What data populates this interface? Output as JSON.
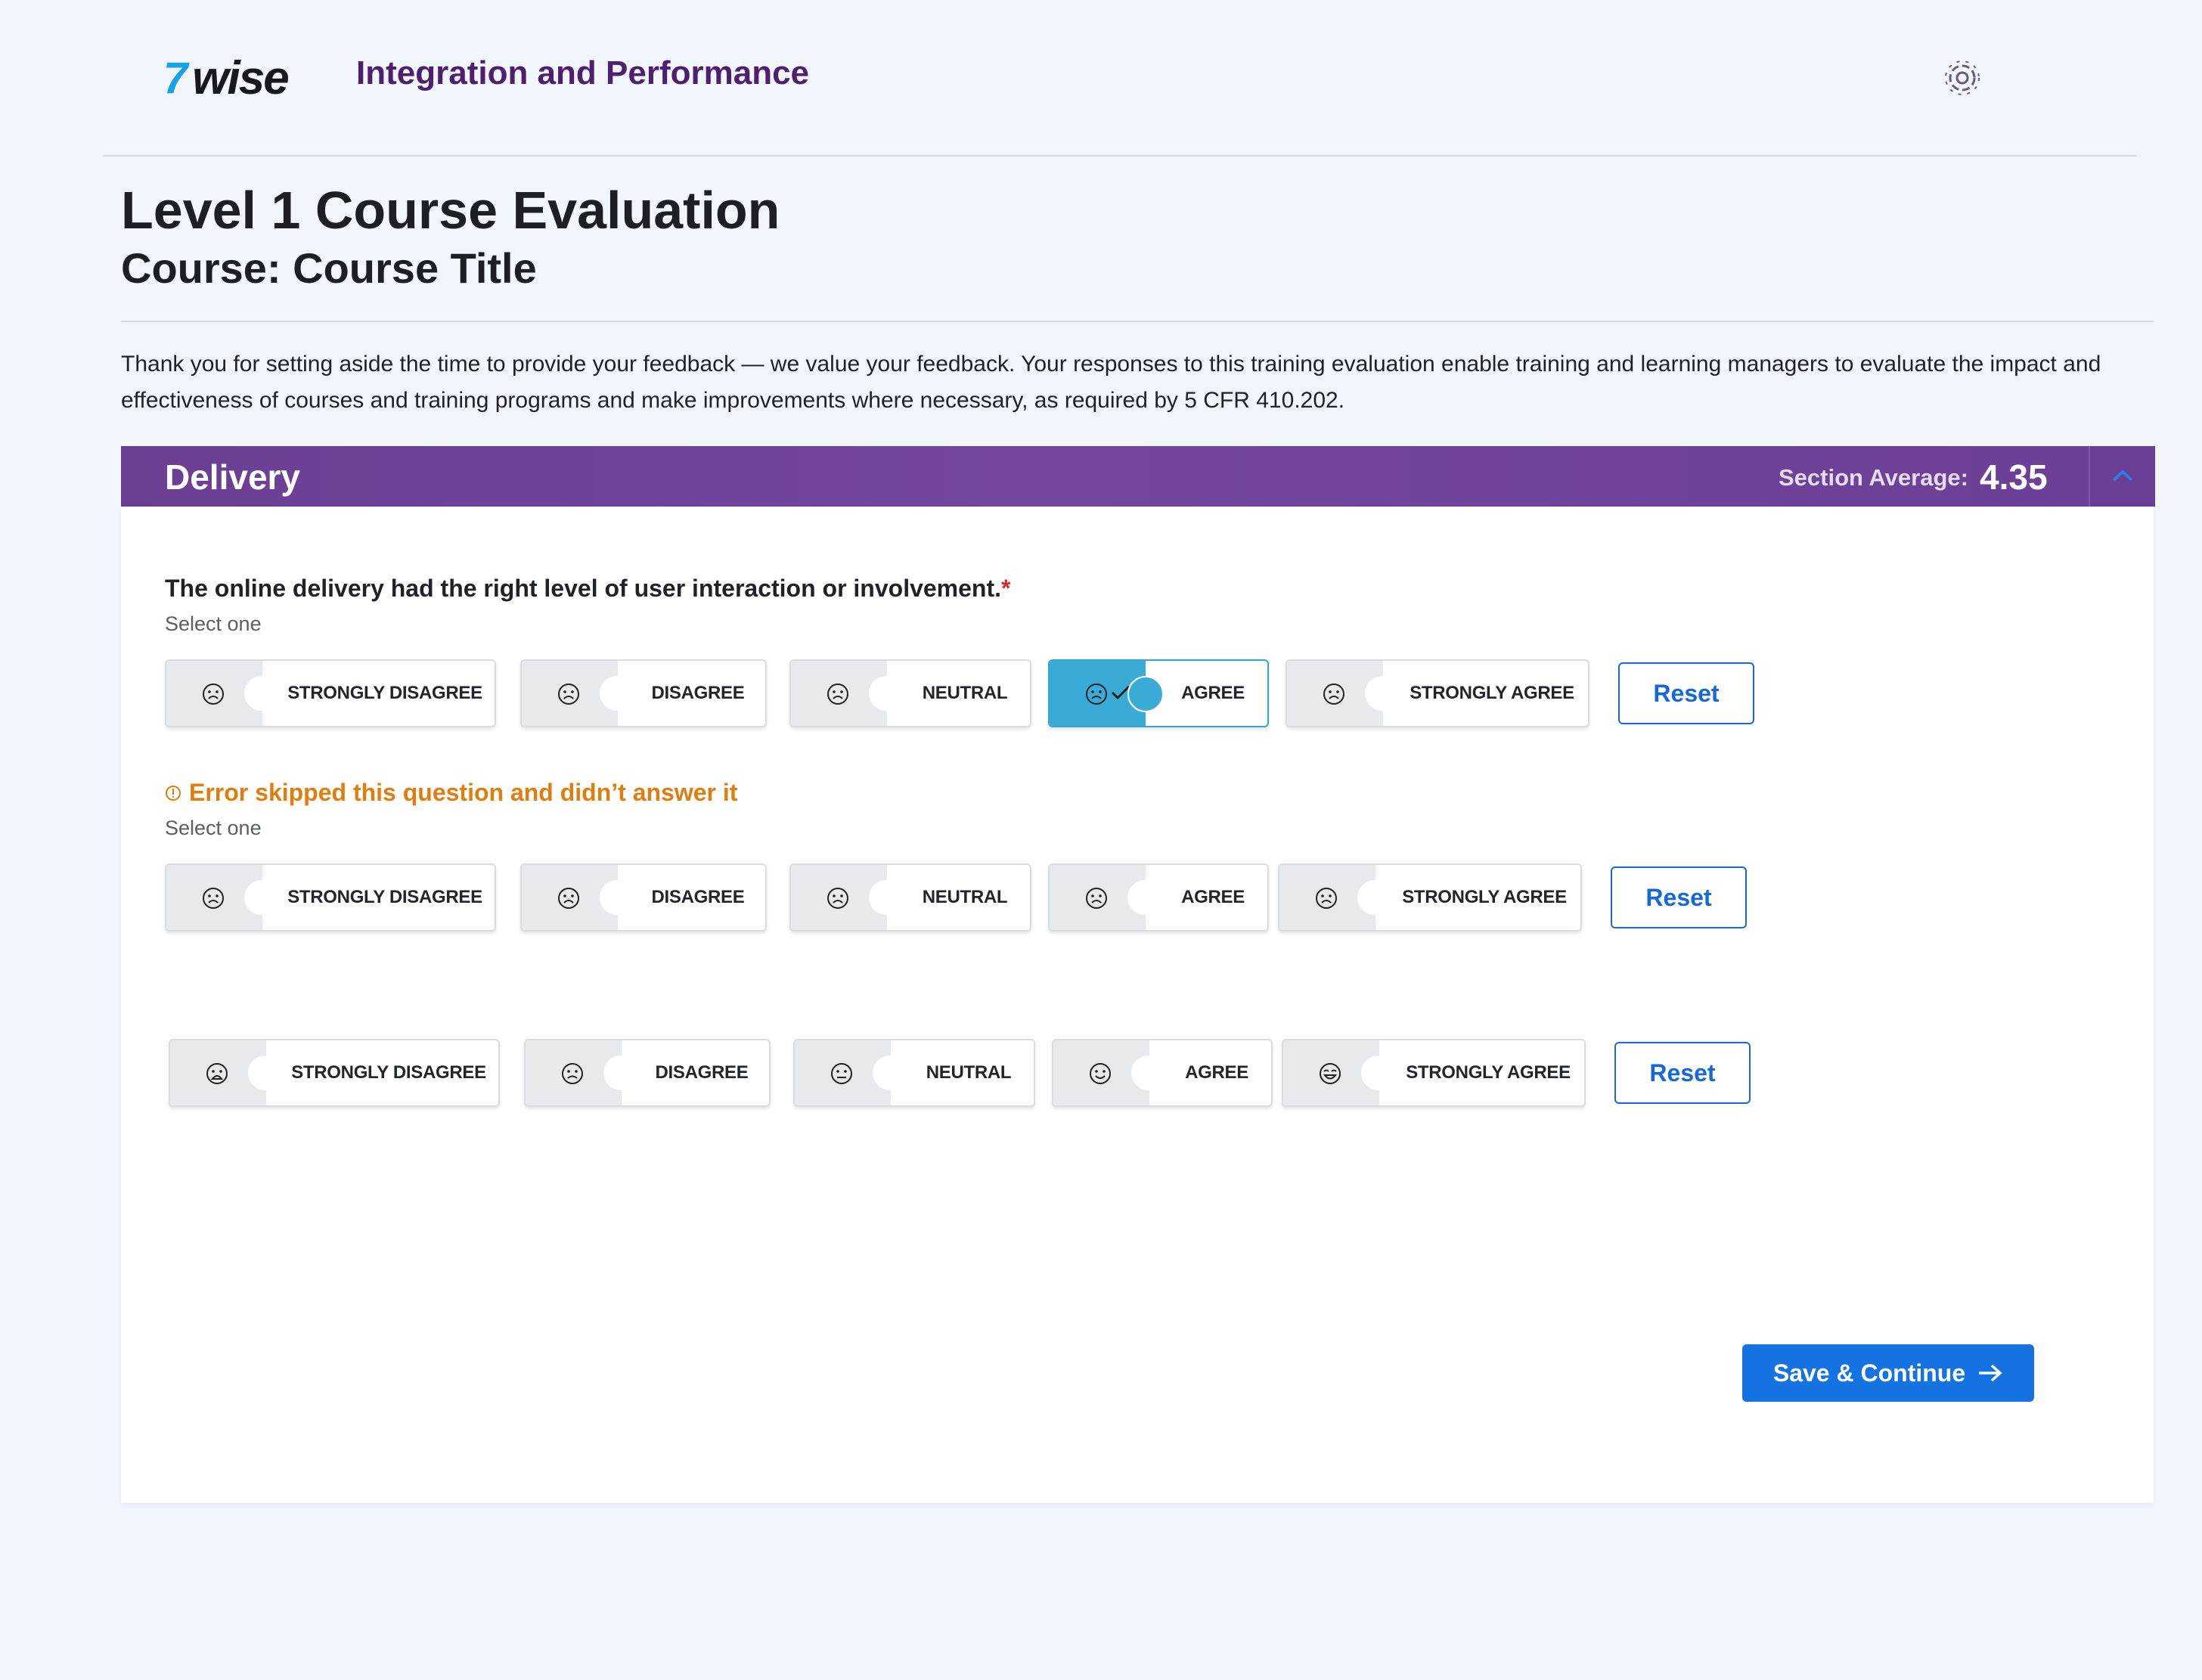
{
  "header": {
    "logo_mark": "7",
    "logo_word": "wise",
    "app_title": "Integration and Performance",
    "settings_icon": "settings-cog-icon"
  },
  "page": {
    "title": "Level 1 Course Evaluation",
    "subtitle": "Course: Course Title",
    "intro": "Thank you for setting aside the time to provide your feedback — we value your feedback. Your responses to this training evaluation enable training and learning managers to evaluate the impact and effectiveness of courses and training programs and make improvements where necessary, as required by 5 CFR 410.202."
  },
  "section": {
    "title": "Delivery",
    "average_label": "Section Average:",
    "average_value": "4.35",
    "collapse_icon": "chevron-up-icon",
    "colors": {
      "header_bg": "#6a3f93",
      "accent": "#3aabd6",
      "primary": "#1473e0",
      "error": "#e07d10"
    }
  },
  "questions": [
    {
      "text": "The online delivery had the right level of user interaction or involvement.",
      "required_mark": "*",
      "hint": "Select one",
      "selected": "AGREE",
      "options": [
        "STRONGLY DISAGREE",
        "DISAGREE",
        "NEUTRAL",
        "AGREE",
        "STRONGLY AGREE"
      ],
      "reset_label": "Reset"
    },
    {
      "error": "Error skipped this question and didn’t answer it",
      "hint": "Select one",
      "options": [
        "STRONGLY DISAGREE",
        "DISAGREE",
        "NEUTRAL",
        "AGREE",
        "STRONGLY AGREE"
      ],
      "reset_label": "Reset"
    },
    {
      "options": [
        "STRONGLY DISAGREE",
        "DISAGREE",
        "NEUTRAL",
        "AGREE",
        "STRONGLY AGREE"
      ],
      "reset_label": "Reset"
    }
  ],
  "footer": {
    "save_label": "Save & Continue",
    "save_icon": "arrow-right-icon"
  }
}
